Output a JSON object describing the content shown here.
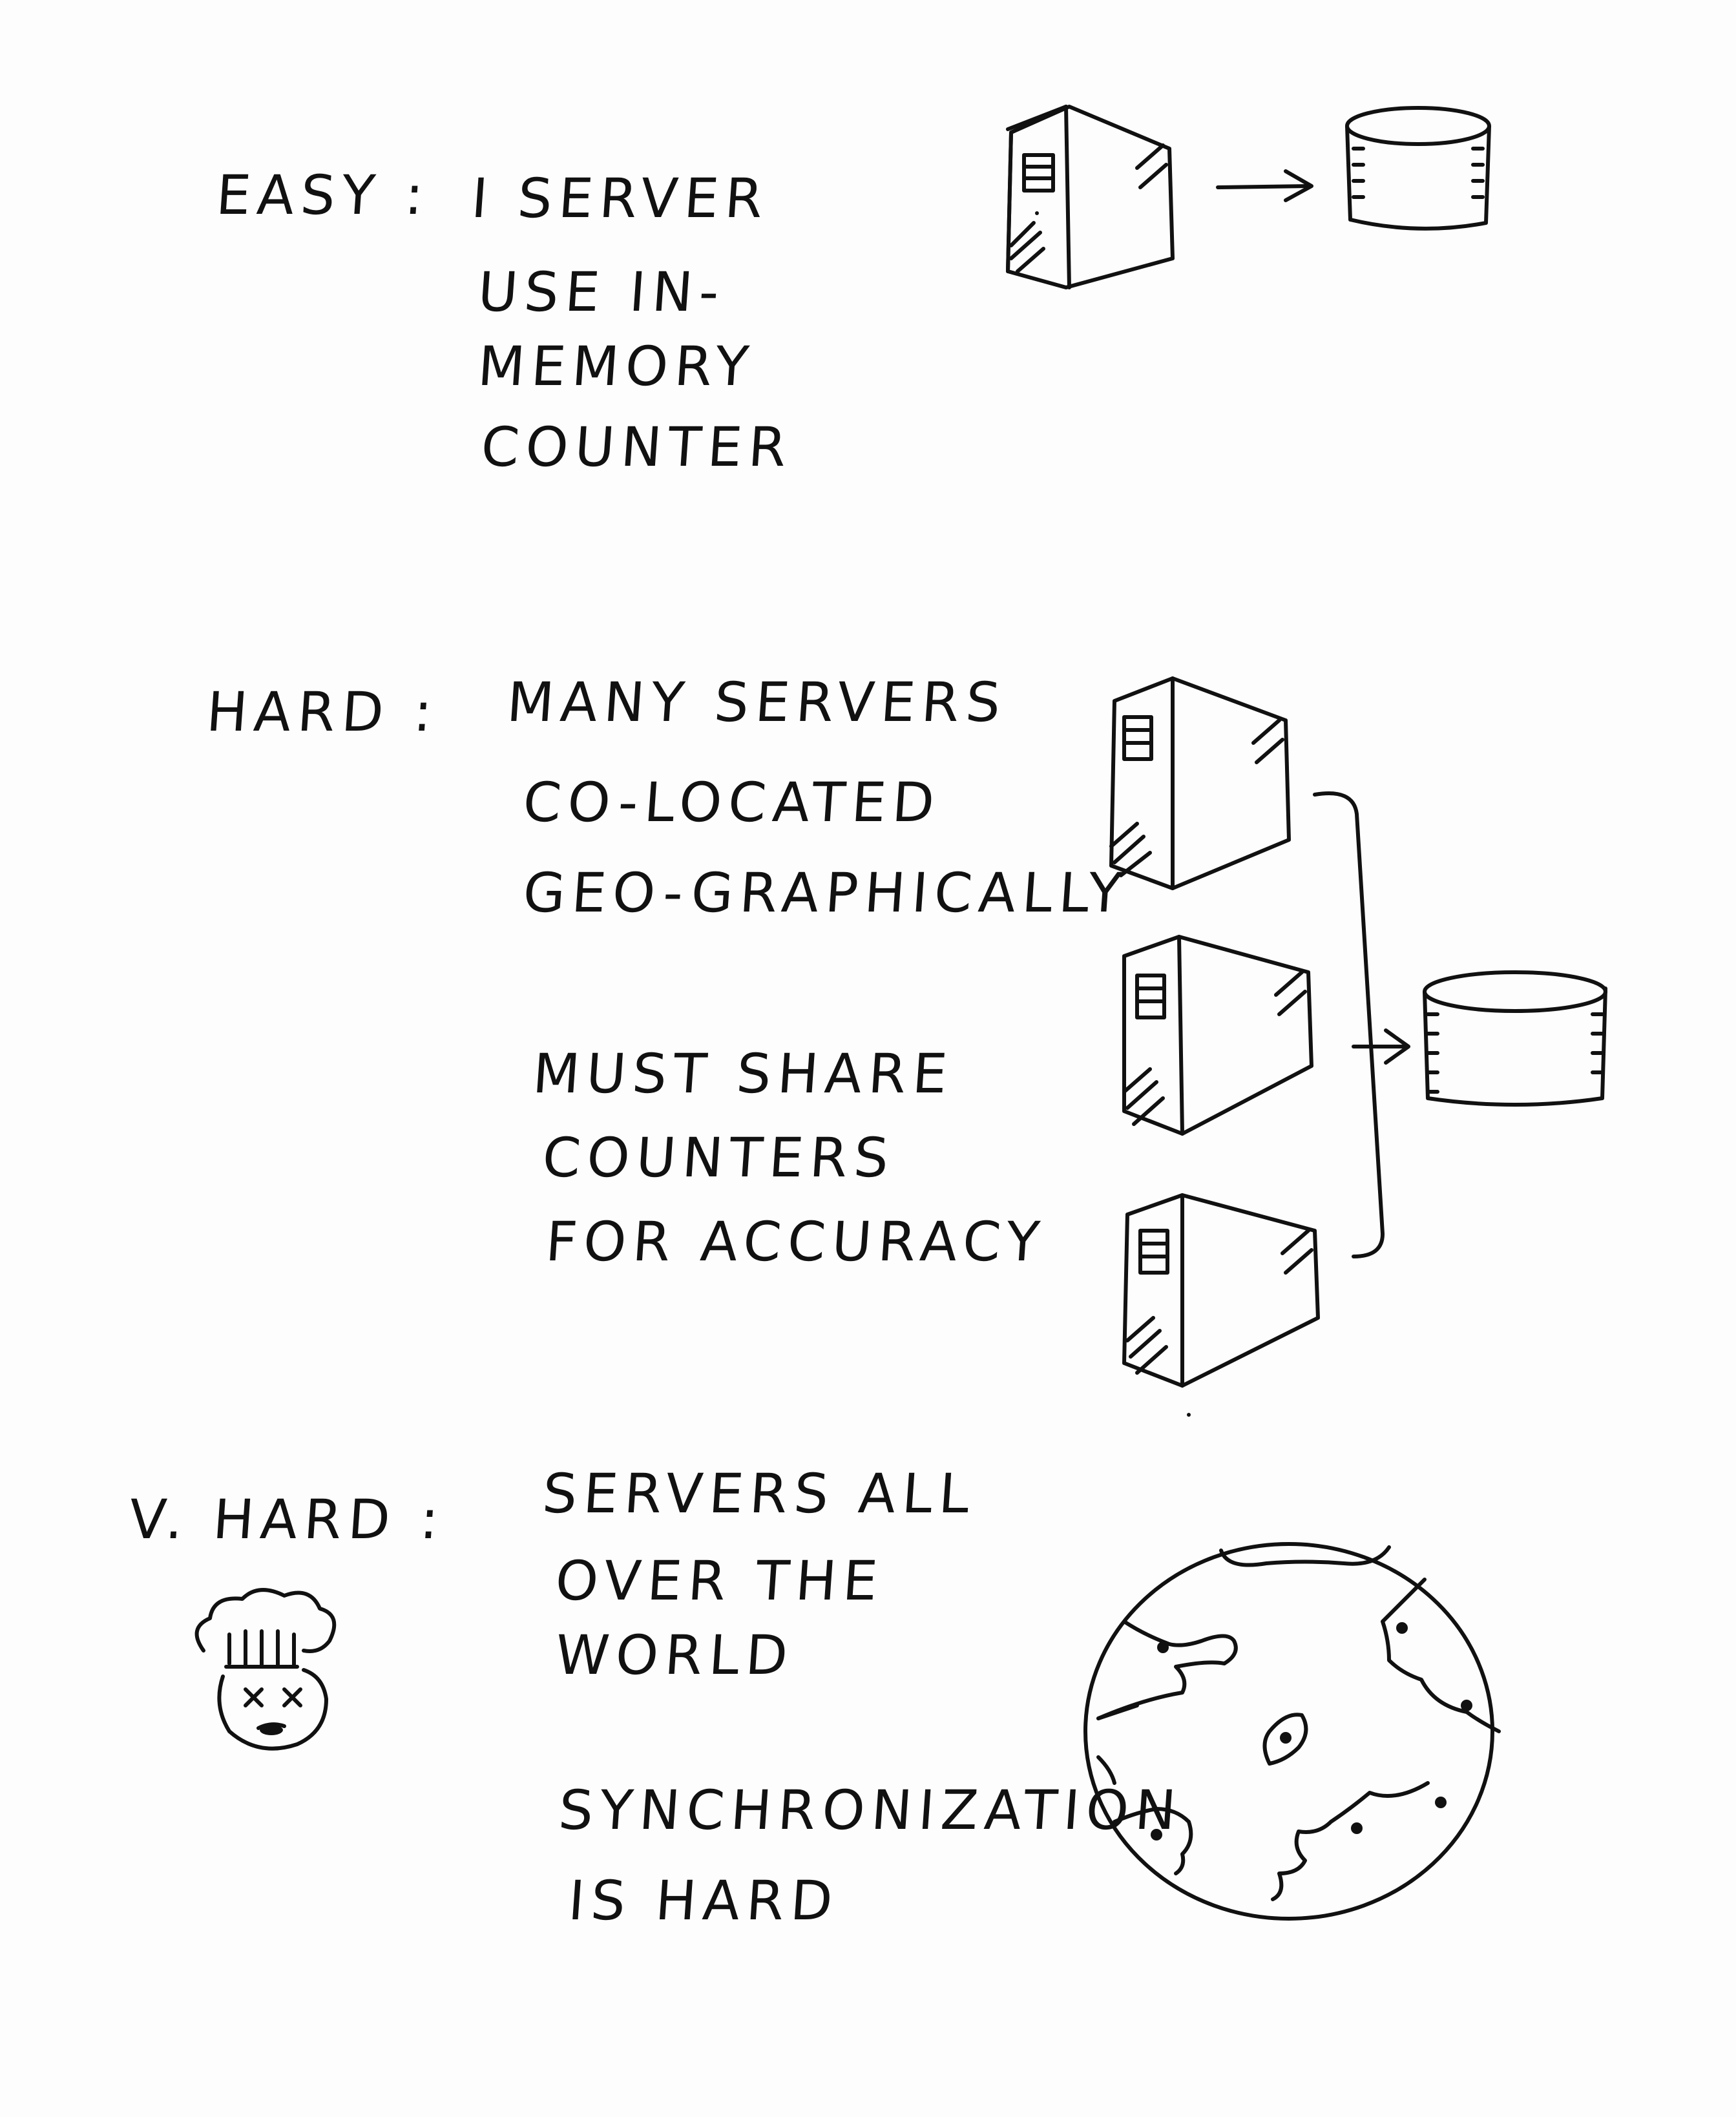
{
  "sections": {
    "easy": {
      "label": "EASY :",
      "lines": [
        "I SERVER",
        "USE IN-",
        "MEMORY",
        "COUNTER"
      ]
    },
    "hard": {
      "label": "HARD :",
      "lines": [
        "MANY SERVERS",
        "CO-LOCATED",
        "GEO-GRAPHICALLY",
        "MUST SHARE",
        "COUNTERS",
        "FOR ACCURACY"
      ]
    },
    "very_hard": {
      "label": "V. HARD :",
      "lines": [
        "SERVERS ALL",
        "OVER THE",
        "WORLD",
        "SYNCHRONIZATION",
        "IS HARD"
      ]
    }
  },
  "icons": {
    "server": "server-tower-icon",
    "database": "database-cylinder-icon",
    "arrow": "arrow-right-icon",
    "face": "dead-face-icon",
    "globe": "globe-icon"
  }
}
